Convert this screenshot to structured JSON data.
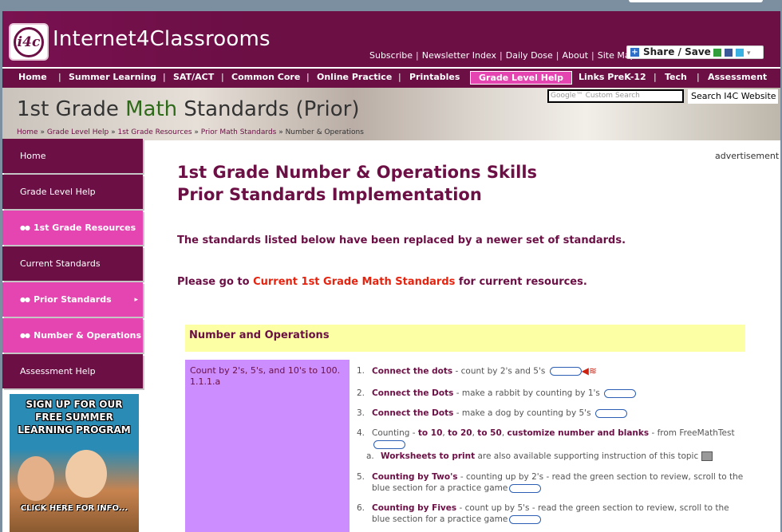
{
  "site": {
    "logo_badge": "i4c",
    "logo_text": "Internet4Classrooms",
    "top_links": [
      "Subscribe",
      "Newsletter Index",
      "Daily Dose",
      "About",
      "Site Map"
    ],
    "share_label": "Share / Save"
  },
  "nav": [
    "Home",
    "Summer Learning",
    "SAT/ACT",
    "Common Core",
    "Online Practice",
    "Printables",
    "Grade Level Help",
    "Links PreK-12",
    "Tech",
    "Assessment"
  ],
  "banner": {
    "title_a": "1st Grade ",
    "title_b": "Math",
    "title_c": " Standards (Prior)",
    "search_placeholder": "Google™ Custom Search",
    "search_button": "Search I4C Website",
    "breadcrumb": [
      "Home",
      "Grade Level Help",
      "1st Grade Resources",
      "Prior Math Standards",
      "Number & Operations"
    ]
  },
  "sidebar": [
    "Home",
    "Grade Level Help",
    "1st Grade Resources",
    "Current Standards",
    "Prior Standards",
    "Number & Operations",
    "Assessment Help"
  ],
  "promo": {
    "text": "SIGN UP FOR OUR FREE SUMMER LEARNING PROGRAM",
    "cta": "CLICK HERE FOR INFO..."
  },
  "advertisement": "advertisement",
  "main": {
    "heading_1": "1st Grade Number & Operations Skills",
    "heading_2": "Prior Standards Implementation",
    "notice": "The standards listed below have been replaced by a newer set of standards.",
    "go_prefix": "Please go to",
    "go_link": "Current 1st Grade Math Standards",
    "go_suffix": "for current resources.",
    "section": "Number and Operations",
    "standard": "Count by 2's, 5's, and 10's to 100. 1.1.1.a",
    "items": [
      {
        "num": "1.",
        "link": "Connect the dots",
        "text": " - count by 2's and 5's"
      },
      {
        "num": "2.",
        "link": "Connect the Dots",
        "text": " - make a rabbit by counting by 1's"
      },
      {
        "num": "3.",
        "link": "Connect the Dots",
        "text": " - make a dog by counting by 5's"
      },
      {
        "num": "4.",
        "pre": "Counting - ",
        "links": [
          "to 10",
          "to 20",
          "to 50",
          "customize number and blanks"
        ],
        "text": " - from FreeMathTest"
      },
      {
        "num": "5.",
        "link": "Counting by Two's",
        "text": " - counting up by 2's - read the green section to review, scroll to the blue section for a practice game"
      },
      {
        "num": "6.",
        "link": "Counting by Fives",
        "text": " - count up by 5's - read the green section to review, scroll to the blue section for a practice game"
      }
    ],
    "subitem": {
      "num": "a.",
      "link": "Worksheets to print",
      "text": " are also available supporting instruction of this topic"
    }
  }
}
